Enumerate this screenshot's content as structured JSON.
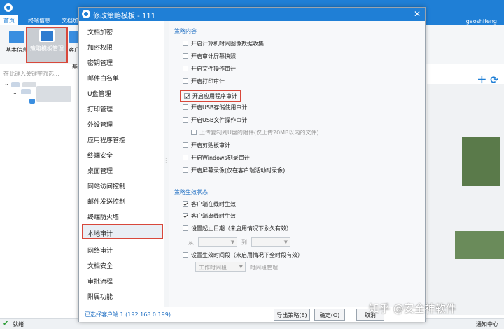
{
  "app": {
    "menu": [
      "首页",
      "终端信息",
      "文档加"
    ],
    "user": "gaoshifeng",
    "ribbon": [
      "基本信息",
      "策略模板管理",
      "客户"
    ],
    "ribbon_side_label": "基",
    "search_placeholder": "在此键入关键字筛选...",
    "status": "就绪",
    "notify": "通知中心"
  },
  "dialog": {
    "title": "修改策略模板 - 111",
    "close": "✕",
    "nav": [
      "文档加密",
      "加密权限",
      "密钥管理",
      "邮件白名单",
      "U盘管理",
      "打印管理",
      "外设管理",
      "应用程序管控",
      "终端安全",
      "桌面管理",
      "网站访问控制",
      "邮件发送控制",
      "终端防火墙",
      "本地审计",
      "网络审计",
      "文档安全",
      "审批流程",
      "附属功能"
    ],
    "section_policy": "策略内容",
    "options": [
      {
        "label": "开启计算机时间图像数据收集",
        "checked": false
      },
      {
        "label": "开启审计屏幕快照",
        "checked": false
      },
      {
        "label": "开启文件操作审计",
        "checked": false
      },
      {
        "label": "开启打印审计",
        "checked": false
      },
      {
        "label": "开启应用程序审计",
        "checked": true
      },
      {
        "label": "开启USB存储使用审计",
        "checked": false
      },
      {
        "label": "开启USB文件操作审计",
        "checked": false
      },
      {
        "label": "上传复制到U盘的附件(仅上传20MB以内的文件)",
        "checked": false
      },
      {
        "label": "开启剪贴板审计",
        "checked": false
      },
      {
        "label": "开启Windows刻录审计",
        "checked": false
      },
      {
        "label": "开启屏幕录像(仅在客户端活动时录像)",
        "checked": false
      }
    ],
    "section_effective": "策略生效状态",
    "effective": [
      {
        "label": "客户端在线时生效",
        "checked": true
      },
      {
        "label": "客户端离线时生效",
        "checked": true
      },
      {
        "label": "设置起止日期（未启用情况下永久有效）",
        "checked": false
      },
      {
        "label": "设置生效时间段（未启用情况下全时段有效）",
        "checked": false
      }
    ],
    "from_label": "从",
    "to_label": "到",
    "time_select": "工作时间段",
    "time_manage": "时间段管理",
    "selected_clients": "已选择客户端 1 (192.168.0.199)",
    "btn_export": "导出策略(E)",
    "btn_ok": "确定(O)",
    "btn_cancel": "取消"
  },
  "watermark": "知乎 @安全神软件",
  "colors": {
    "accent": "#1f7fd6",
    "highlight": "#d8483b"
  }
}
